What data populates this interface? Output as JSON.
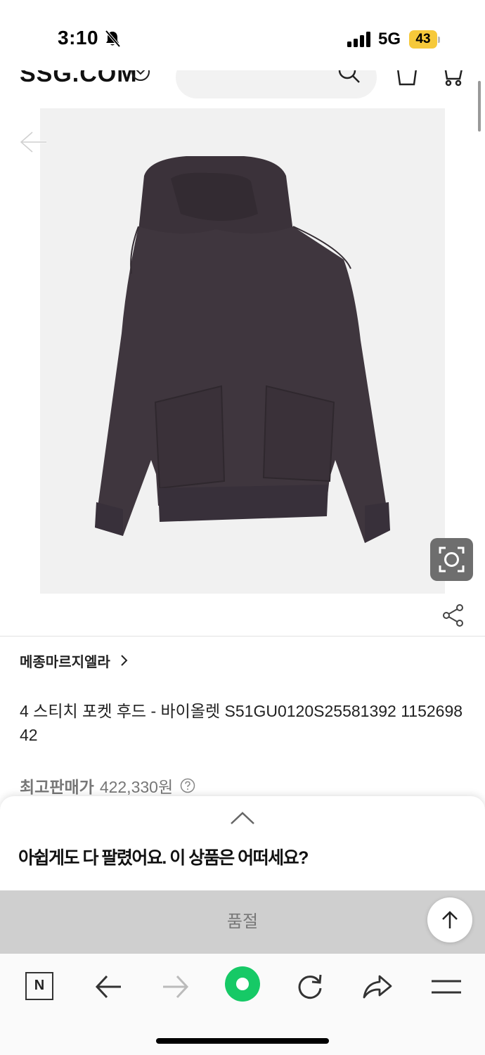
{
  "status_bar": {
    "time": "3:10",
    "network": "5G",
    "battery": "43"
  },
  "header": {
    "logo": "SSG.COM"
  },
  "product": {
    "brand": "메종마르지엘라",
    "title": "4 스티치 포켓 후드 - 바이올렛 S51GU0120S25581392 115269842",
    "price_label": "최고판매가",
    "price_value": "422,330원"
  },
  "bottom_sheet": {
    "message": "아쉽게도 다 팔렸어요. 이 상품은 어떠세요?",
    "soldout_label": "품절"
  },
  "browser_toolbar": {
    "naver_label": "N"
  },
  "colors": {
    "hoodie": "#3f363e",
    "image_bg": "#f1f1f1",
    "naver_green": "#16c966",
    "battery": "#f6c93a",
    "soldout_bar": "#cfcfcf"
  }
}
